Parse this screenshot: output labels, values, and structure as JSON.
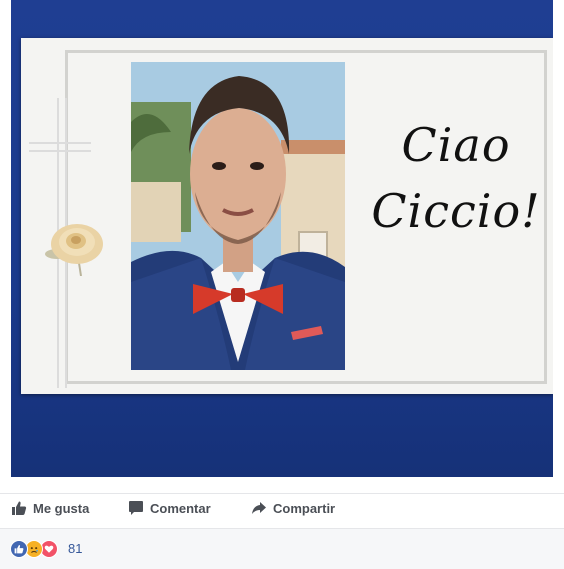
{
  "post": {
    "image_caption_line1": "Ciao",
    "image_caption_line2": "Ciccio!"
  },
  "actions": {
    "like_label": "Me gusta",
    "comment_label": "Comentar",
    "share_label": "Compartir"
  },
  "reactions": {
    "icons": [
      "like-icon",
      "sad-icon",
      "love-icon"
    ],
    "count": "81"
  },
  "colors": {
    "background_blue": "#1a3a8c",
    "like_blue": "#4267b2",
    "love_red": "#f25268",
    "sad_yellow": "#f7b125",
    "action_gray": "#4b4f56",
    "link_blue": "#365899"
  }
}
